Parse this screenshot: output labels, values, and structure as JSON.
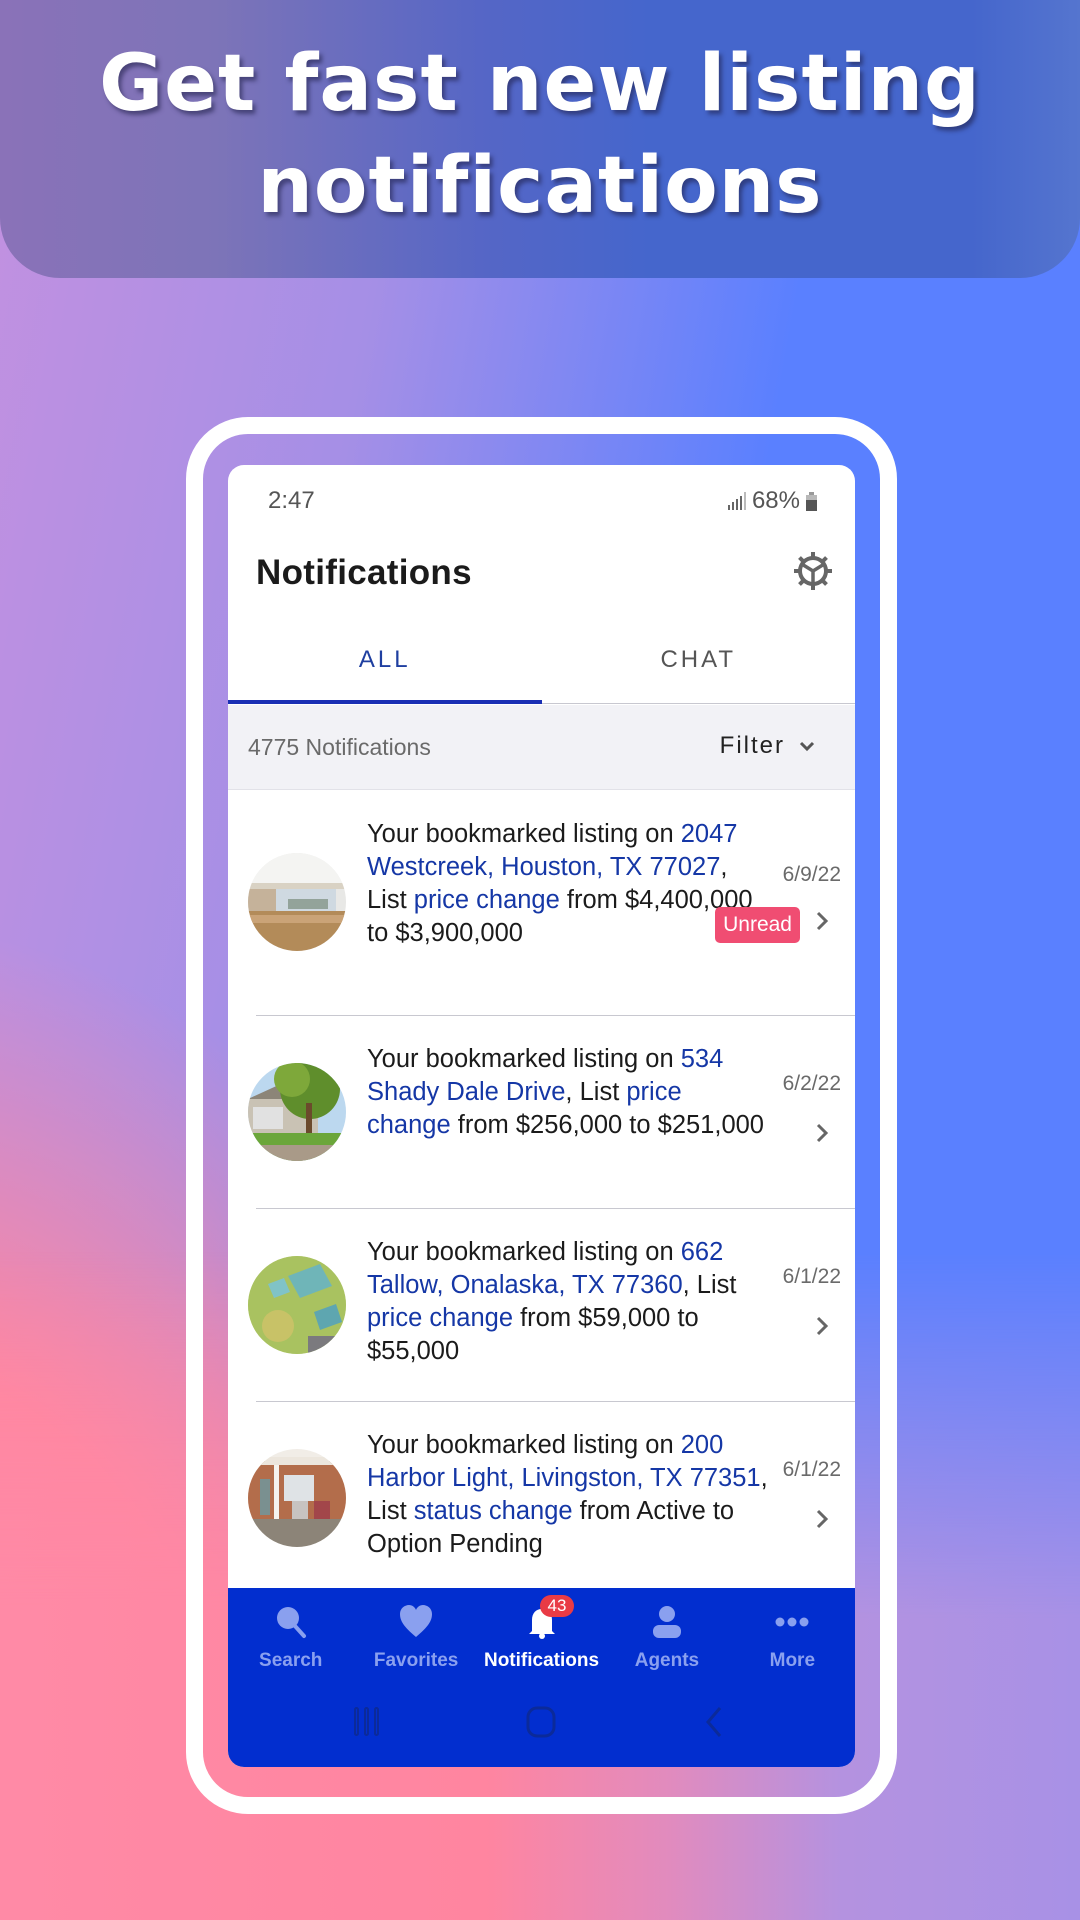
{
  "promo": {
    "headline_line1": "Get fast new listing",
    "headline_line2": "notifications"
  },
  "status_bar": {
    "time": "2:47",
    "battery": "68%",
    "icons": [
      "signal-icon",
      "battery-icon"
    ]
  },
  "header": {
    "title": "Notifications",
    "settings_icon": "gear-icon"
  },
  "tabs": [
    {
      "label": "ALL",
      "active": true
    },
    {
      "label": "CHAT",
      "active": false
    }
  ],
  "summary": {
    "count_text": "4775 Notifications",
    "filter_label": "Filter",
    "filter_icon": "chevron-down-icon"
  },
  "notifications": [
    {
      "parts": [
        {
          "text": "Your bookmarked listing on ",
          "link": false
        },
        {
          "text": "2047 Westcreek, Houston, TX 77027",
          "link": true
        },
        {
          "text": ", List ",
          "link": false
        },
        {
          "text": "price change",
          "link": true
        },
        {
          "text": " from $4,400,000 to $3,900,000",
          "link": false
        }
      ],
      "date": "6/9/22",
      "unread": true,
      "unread_label": "Unread",
      "thumb": "interior-room"
    },
    {
      "parts": [
        {
          "text": "Your bookmarked listing on ",
          "link": false
        },
        {
          "text": "534 Shady Dale Drive",
          "link": true
        },
        {
          "text": ", List ",
          "link": false
        },
        {
          "text": "price change",
          "link": true
        },
        {
          "text": " from $256,000 to $251,000",
          "link": false
        }
      ],
      "date": "6/2/22",
      "unread": false,
      "thumb": "house-tree"
    },
    {
      "parts": [
        {
          "text": "Your bookmarked listing on ",
          "link": false
        },
        {
          "text": "662 Tallow, Onalaska, TX 77360",
          "link": true
        },
        {
          "text": ", List ",
          "link": false
        },
        {
          "text": "price change",
          "link": true
        },
        {
          "text": " from $59,000 to $55,000",
          "link": false
        }
      ],
      "date": "6/1/22",
      "unread": false,
      "thumb": "aerial-lot"
    },
    {
      "parts": [
        {
          "text": "Your bookmarked listing on ",
          "link": false
        },
        {
          "text": "200 Harbor Light, Livingston, TX 77351",
          "link": true
        },
        {
          "text": ", List ",
          "link": false
        },
        {
          "text": "status change",
          "link": true
        },
        {
          "text": " from Active to Option Pending",
          "link": false
        }
      ],
      "date": "6/1/22",
      "unread": false,
      "thumb": "porch"
    }
  ],
  "bottom_nav": [
    {
      "label": "Search",
      "icon": "search-icon",
      "active": false
    },
    {
      "label": "Favorites",
      "icon": "heart-icon",
      "active": false
    },
    {
      "label": "Notifications",
      "icon": "bell-icon",
      "active": true,
      "badge": "43"
    },
    {
      "label": "Agents",
      "icon": "person-icon",
      "active": false
    },
    {
      "label": "More",
      "icon": "more-dots-icon",
      "active": false
    }
  ],
  "system_nav": [
    "recent-apps-icon",
    "home-icon",
    "back-icon"
  ],
  "colors": {
    "accent": "#1537a6",
    "tab_indicator": "#1a2fb4",
    "nav_bg": "#022ecf",
    "unread_badge": "#f04d72",
    "count_badge": "#e93b45"
  }
}
